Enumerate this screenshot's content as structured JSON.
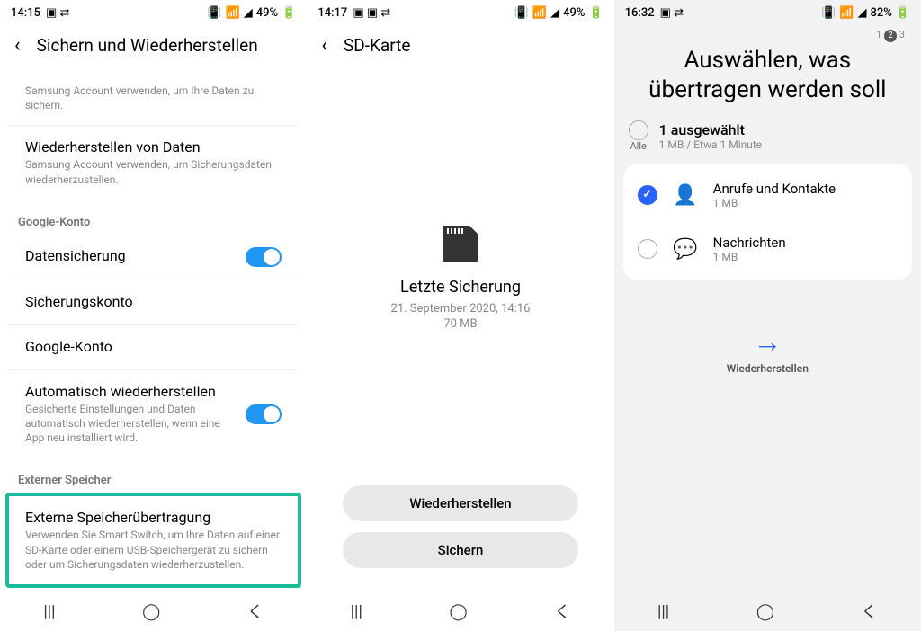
{
  "screen1": {
    "status": {
      "time": "14:15",
      "battery": "49%"
    },
    "title": "Sichern und Wiederherstellen",
    "samsung_sub": "Samsung Account verwenden, um Ihre Daten zu sichern.",
    "restore_title": "Wiederherstellen von Daten",
    "restore_sub": "Samsung Account verwenden, um Sicherungsdaten wiederherzustellen.",
    "google_section": "Google-Konto",
    "data_backup": "Datensicherung",
    "backup_account": "Sicherungskonto",
    "google_account": "Google-Konto",
    "auto_restore": "Automatisch wiederherstellen",
    "auto_restore_sub": "Gesicherte Einstellungen und Daten automatisch wiederherstellen, wenn eine App neu installiert wird.",
    "external_section": "Externer Speicher",
    "external_title": "Externe Speicherübertragung",
    "external_sub": "Verwenden Sie Smart Switch, um Ihre Daten auf einer SD-Karte oder einem USB-Speichergerät zu sichern oder um Sicherungsdaten wiederherzustellen."
  },
  "screen2": {
    "status": {
      "time": "14:17",
      "battery": "49%"
    },
    "title": "SD-Karte",
    "center_title": "Letzte Sicherung",
    "center_date": "21. September 2020, 14:16",
    "center_size": "70 MB",
    "btn_restore": "Wiederherstellen",
    "btn_backup": "Sichern"
  },
  "screen3": {
    "status": {
      "time": "16:32",
      "battery": "82%"
    },
    "steps": {
      "s1": "1",
      "s2": "2",
      "s3": "3"
    },
    "big_title": "Auswählen, was übertragen werden soll",
    "alle": "Alle",
    "selected_count": "1 ausgewählt",
    "selected_sub": "1 MB / Etwa 1 Minute",
    "item1": {
      "title": "Anrufe und Kontakte",
      "size": "1 MB"
    },
    "item2": {
      "title": "Nachrichten",
      "size": "1 MB"
    },
    "restore": "Wiederherstellen"
  }
}
